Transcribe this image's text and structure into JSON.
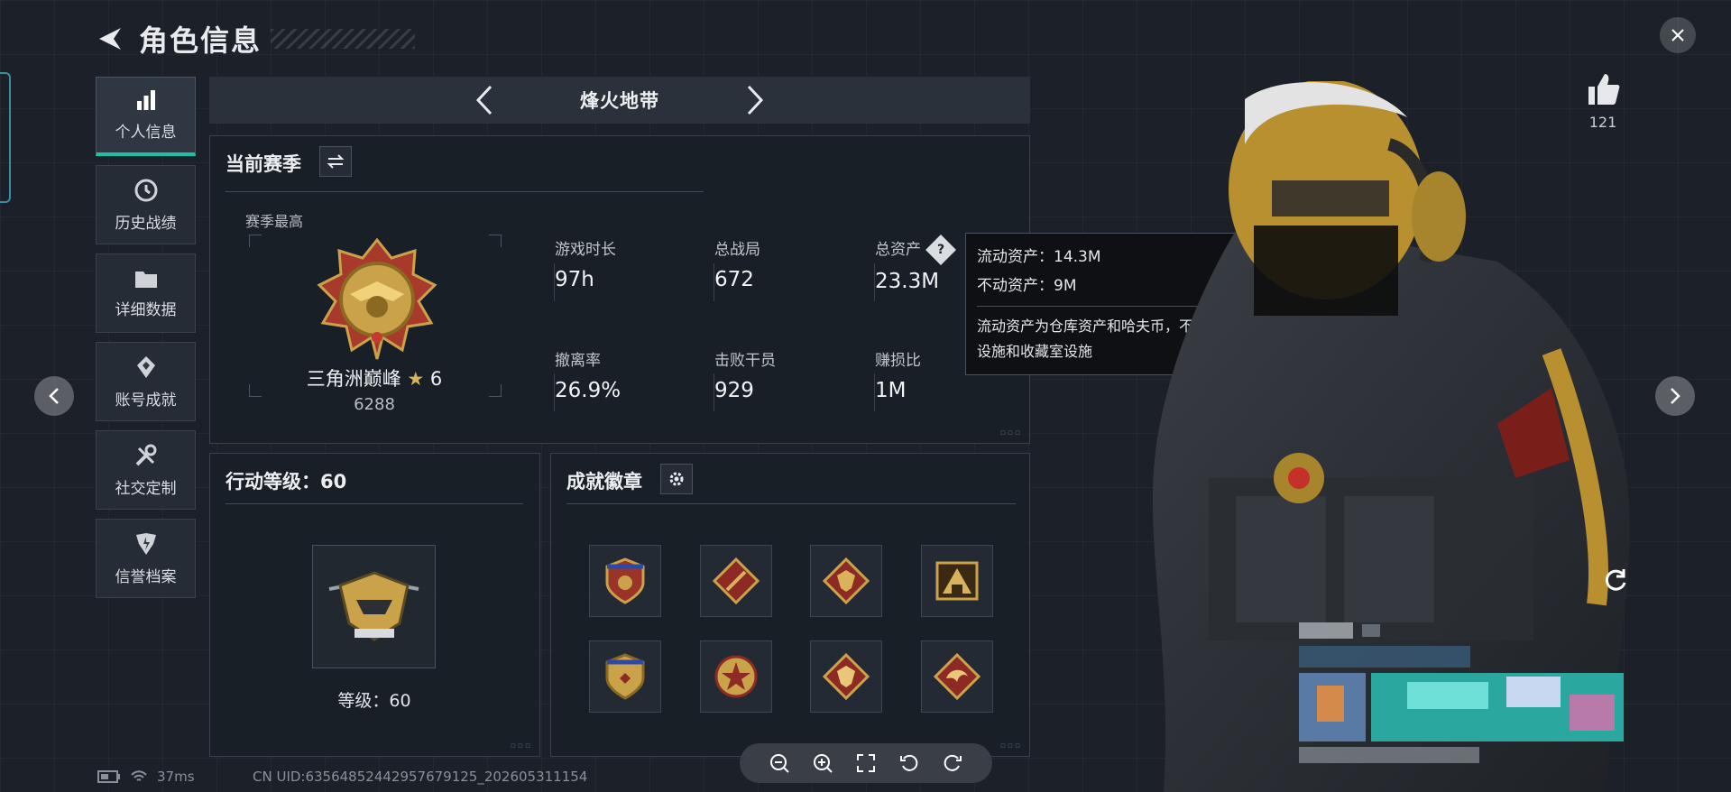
{
  "header": {
    "title": "角色信息"
  },
  "sidebar": {
    "items": [
      {
        "label": "个人信息",
        "icon": "bar-chart-icon",
        "active": true
      },
      {
        "label": "历史战绩",
        "icon": "history-clock-icon"
      },
      {
        "label": "详细数据",
        "icon": "folder-icon"
      },
      {
        "label": "账号成就",
        "icon": "achievement-gem-icon"
      },
      {
        "label": "社交定制",
        "icon": "tools-icon"
      },
      {
        "label": "信誉档案",
        "icon": "reputation-icon"
      }
    ]
  },
  "mode": {
    "title": "烽火地带"
  },
  "season": {
    "title": "当前赛季",
    "best_label": "赛季最高",
    "rank_name": "三角洲巅峰",
    "rank_stars": "6",
    "rank_points": "6288",
    "stats": [
      {
        "label": "游戏时长",
        "value": "97h"
      },
      {
        "label": "总战局",
        "value": "672"
      },
      {
        "label": "总资产",
        "value": "23.3M"
      },
      {
        "label": "撤离率",
        "value": "26.9%"
      },
      {
        "label": "击败干员",
        "value": "929"
      },
      {
        "label": "赚损比",
        "value": "1M"
      }
    ]
  },
  "tooltip": {
    "liquid": "流动资产：14.3M",
    "fixed": "不动资产：9M",
    "description": "流动资产为仓库资产和哈夫币，不动资产为特勤处设施和收藏室设施"
  },
  "level": {
    "title": "行动等级：60",
    "text": "等级：60"
  },
  "achievements": {
    "title": "成就徽章",
    "badges": [
      "badge-shield-red",
      "badge-diamond-knife",
      "badge-diamond-wolf",
      "badge-triangle-gold",
      "badge-shield-gold",
      "badge-star-medal",
      "badge-diamond-wolf-2",
      "badge-diamond-dragon"
    ]
  },
  "like": {
    "count": "121"
  },
  "status": {
    "ping": "37ms",
    "uid": "CN UID:6356485244295767912​5_202605311154"
  },
  "colors": {
    "accent": "#19c2a7",
    "panel_bg": "#1a1f27",
    "gold": "#c9a24a",
    "badge_red": "#8e2a24"
  }
}
